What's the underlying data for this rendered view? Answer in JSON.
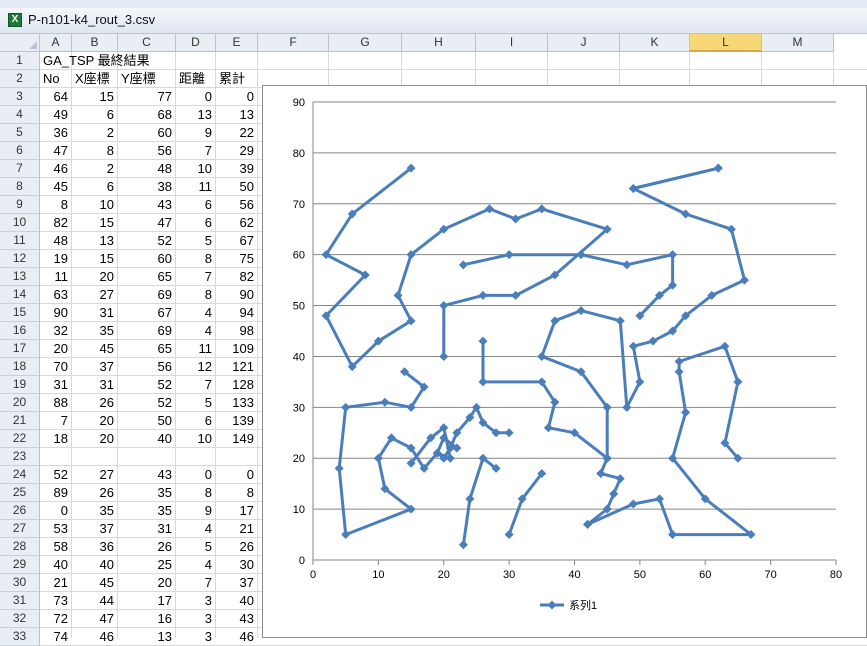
{
  "window": {
    "title": "P-n101-k4_rout_3.csv",
    "icon": "excel-icon"
  },
  "selected_column": "L",
  "columns": [
    "A",
    "B",
    "C",
    "D",
    "E",
    "F",
    "G",
    "H",
    "I",
    "J",
    "K",
    "L",
    "M"
  ],
  "rows": [
    {
      "n": "1",
      "text": "GA_TSP 最終結果"
    },
    {
      "n": "2",
      "h": [
        "No",
        "X座標",
        "Y座標",
        "距離",
        "累計"
      ]
    },
    {
      "n": "3",
      "v": [
        "64",
        "15",
        "77",
        "0",
        "0"
      ]
    },
    {
      "n": "4",
      "v": [
        "49",
        "6",
        "68",
        "13",
        "13"
      ]
    },
    {
      "n": "5",
      "v": [
        "36",
        "2",
        "60",
        "9",
        "22"
      ]
    },
    {
      "n": "6",
      "v": [
        "47",
        "8",
        "56",
        "7",
        "29"
      ]
    },
    {
      "n": "7",
      "v": [
        "46",
        "2",
        "48",
        "10",
        "39"
      ]
    },
    {
      "n": "8",
      "v": [
        "45",
        "6",
        "38",
        "11",
        "50"
      ]
    },
    {
      "n": "9",
      "v": [
        "8",
        "10",
        "43",
        "6",
        "56"
      ]
    },
    {
      "n": "10",
      "v": [
        "82",
        "15",
        "47",
        "6",
        "62"
      ]
    },
    {
      "n": "11",
      "v": [
        "48",
        "13",
        "52",
        "5",
        "67"
      ]
    },
    {
      "n": "12",
      "v": [
        "19",
        "15",
        "60",
        "8",
        "75"
      ]
    },
    {
      "n": "13",
      "v": [
        "11",
        "20",
        "65",
        "7",
        "82"
      ]
    },
    {
      "n": "14",
      "v": [
        "63",
        "27",
        "69",
        "8",
        "90"
      ]
    },
    {
      "n": "15",
      "v": [
        "90",
        "31",
        "67",
        "4",
        "94"
      ]
    },
    {
      "n": "16",
      "v": [
        "32",
        "35",
        "69",
        "4",
        "98"
      ]
    },
    {
      "n": "17",
      "v": [
        "20",
        "45",
        "65",
        "11",
        "109"
      ]
    },
    {
      "n": "18",
      "v": [
        "70",
        "37",
        "56",
        "12",
        "121"
      ]
    },
    {
      "n": "19",
      "v": [
        "31",
        "31",
        "52",
        "7",
        "128"
      ]
    },
    {
      "n": "20",
      "v": [
        "88",
        "26",
        "52",
        "5",
        "133"
      ]
    },
    {
      "n": "21",
      "v": [
        "7",
        "20",
        "50",
        "6",
        "139"
      ]
    },
    {
      "n": "22",
      "v": [
        "18",
        "20",
        "40",
        "10",
        "149"
      ]
    },
    {
      "n": "23",
      "v": [
        "",
        "",
        "",
        "",
        ""
      ]
    },
    {
      "n": "24",
      "v": [
        "52",
        "27",
        "43",
        "0",
        "0"
      ]
    },
    {
      "n": "25",
      "v": [
        "89",
        "26",
        "35",
        "8",
        "8"
      ]
    },
    {
      "n": "26",
      "v": [
        "0",
        "35",
        "35",
        "9",
        "17"
      ]
    },
    {
      "n": "27",
      "v": [
        "53",
        "37",
        "31",
        "4",
        "21"
      ]
    },
    {
      "n": "28",
      "v": [
        "58",
        "36",
        "26",
        "5",
        "26"
      ]
    },
    {
      "n": "29",
      "v": [
        "40",
        "40",
        "25",
        "4",
        "30"
      ]
    },
    {
      "n": "30",
      "v": [
        "21",
        "45",
        "20",
        "7",
        "37"
      ]
    },
    {
      "n": "31",
      "v": [
        "73",
        "44",
        "17",
        "3",
        "40"
      ]
    },
    {
      "n": "32",
      "v": [
        "72",
        "47",
        "16",
        "3",
        "43"
      ]
    },
    {
      "n": "33",
      "v": [
        "74",
        "46",
        "13",
        "3",
        "46"
      ]
    }
  ],
  "chart_data": {
    "type": "scatter",
    "mode": "lines+markers",
    "color": "#4a7ebb",
    "xlim": [
      0,
      80
    ],
    "ylim": [
      0,
      90
    ],
    "xticks": [
      "0",
      "10",
      "20",
      "30",
      "40",
      "50",
      "60",
      "70",
      "80"
    ],
    "yticks": [
      "0",
      "10",
      "20",
      "30",
      "40",
      "50",
      "60",
      "70",
      "80",
      "90"
    ],
    "grid": "horizontal",
    "legend": {
      "position": "bottom",
      "label": "系列1"
    },
    "series": [
      {
        "name": "系列1",
        "paths": [
          [
            [
              15,
              77
            ],
            [
              6,
              68
            ],
            [
              2,
              60
            ],
            [
              8,
              56
            ],
            [
              2,
              48
            ],
            [
              6,
              38
            ],
            [
              10,
              43
            ],
            [
              15,
              47
            ],
            [
              13,
              52
            ],
            [
              15,
              60
            ],
            [
              20,
              65
            ],
            [
              27,
              69
            ],
            [
              31,
              67
            ],
            [
              35,
              69
            ],
            [
              45,
              65
            ],
            [
              37,
              56
            ],
            [
              31,
              52
            ],
            [
              26,
              52
            ],
            [
              20,
              50
            ],
            [
              20,
              40
            ]
          ],
          [
            [
              62,
              77
            ],
            [
              49,
              73
            ]
          ],
          [
            [
              62,
              77
            ],
            [
              49,
              73
            ],
            [
              57,
              68
            ],
            [
              64,
              65
            ],
            [
              66,
              55
            ],
            [
              61,
              52
            ],
            [
              57,
              48
            ],
            [
              55,
              45
            ],
            [
              52,
              43
            ],
            [
              49,
              42
            ],
            [
              50,
              35
            ],
            [
              48,
              30
            ],
            [
              47,
              47
            ],
            [
              41,
              49
            ],
            [
              37,
              47
            ],
            [
              35,
              40
            ],
            [
              41,
              37
            ],
            [
              45,
              30
            ],
            [
              45,
              20
            ],
            [
              40,
              25
            ],
            [
              36,
              26
            ],
            [
              37,
              31
            ],
            [
              35,
              35
            ],
            [
              26,
              35
            ],
            [
              26,
              43
            ]
          ],
          [
            [
              23,
              58
            ],
            [
              30,
              60
            ],
            [
              41,
              60
            ],
            [
              48,
              58
            ],
            [
              55,
              60
            ],
            [
              55,
              54
            ],
            [
              53,
              52
            ],
            [
              50,
              48
            ]
          ],
          [
            [
              14,
              37
            ],
            [
              17,
              34
            ],
            [
              15,
              30
            ],
            [
              11,
              31
            ],
            [
              5,
              30
            ],
            [
              4,
              18
            ],
            [
              5,
              5
            ],
            [
              15,
              10
            ],
            [
              11,
              14
            ],
            [
              10,
              20
            ],
            [
              12,
              24
            ],
            [
              15,
              22
            ],
            [
              17,
              18
            ],
            [
              19,
              21
            ],
            [
              20,
              20
            ],
            [
              21,
              22
            ],
            [
              22,
              25
            ],
            [
              24,
              28
            ],
            [
              25,
              30
            ],
            [
              26,
              27
            ],
            [
              28,
              25
            ],
            [
              30,
              25
            ]
          ],
          [
            [
              15,
              19
            ],
            [
              18,
              24
            ],
            [
              20,
              26
            ],
            [
              21,
              20
            ],
            [
              19,
              21
            ],
            [
              20,
              24
            ],
            [
              22,
              22
            ]
          ],
          [
            [
              23,
              3
            ],
            [
              24,
              12
            ],
            [
              26,
              20
            ],
            [
              28,
              18
            ]
          ],
          [
            [
              30,
              5
            ],
            [
              32,
              12
            ],
            [
              35,
              17
            ]
          ],
          [
            [
              42,
              7
            ],
            [
              45,
              10
            ],
            [
              46,
              13
            ],
            [
              47,
              16
            ],
            [
              44,
              17
            ],
            [
              45,
              20
            ]
          ],
          [
            [
              42,
              7
            ],
            [
              49,
              11
            ],
            [
              53,
              12
            ],
            [
              55,
              5
            ],
            [
              67,
              5
            ],
            [
              60,
              12
            ],
            [
              55,
              20
            ],
            [
              57,
              29
            ],
            [
              56,
              37
            ],
            [
              56,
              39
            ],
            [
              63,
              42
            ],
            [
              65,
              35
            ],
            [
              63,
              23
            ],
            [
              65,
              20
            ]
          ]
        ]
      }
    ]
  }
}
